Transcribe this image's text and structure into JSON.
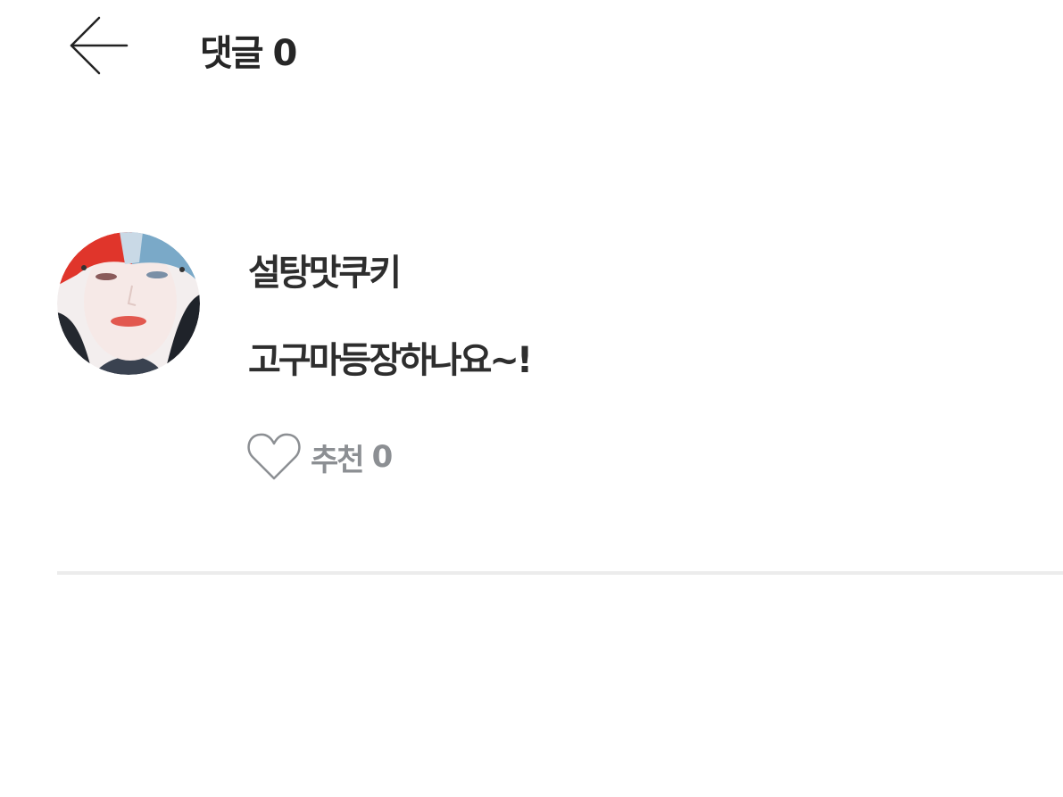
{
  "header": {
    "back_icon": "arrow-left-icon",
    "title": "댓글 0"
  },
  "comment": {
    "avatar": "profile-photo",
    "author": "설탕맛쿠키",
    "text": "고구마등장하나요~!",
    "like_icon": "heart-outline-icon",
    "like_label": "추천",
    "like_count": "0"
  },
  "colors": {
    "text": "#2e2e2e",
    "muted": "#8c8f93",
    "divider": "#ececec",
    "background": "#ffffff"
  }
}
